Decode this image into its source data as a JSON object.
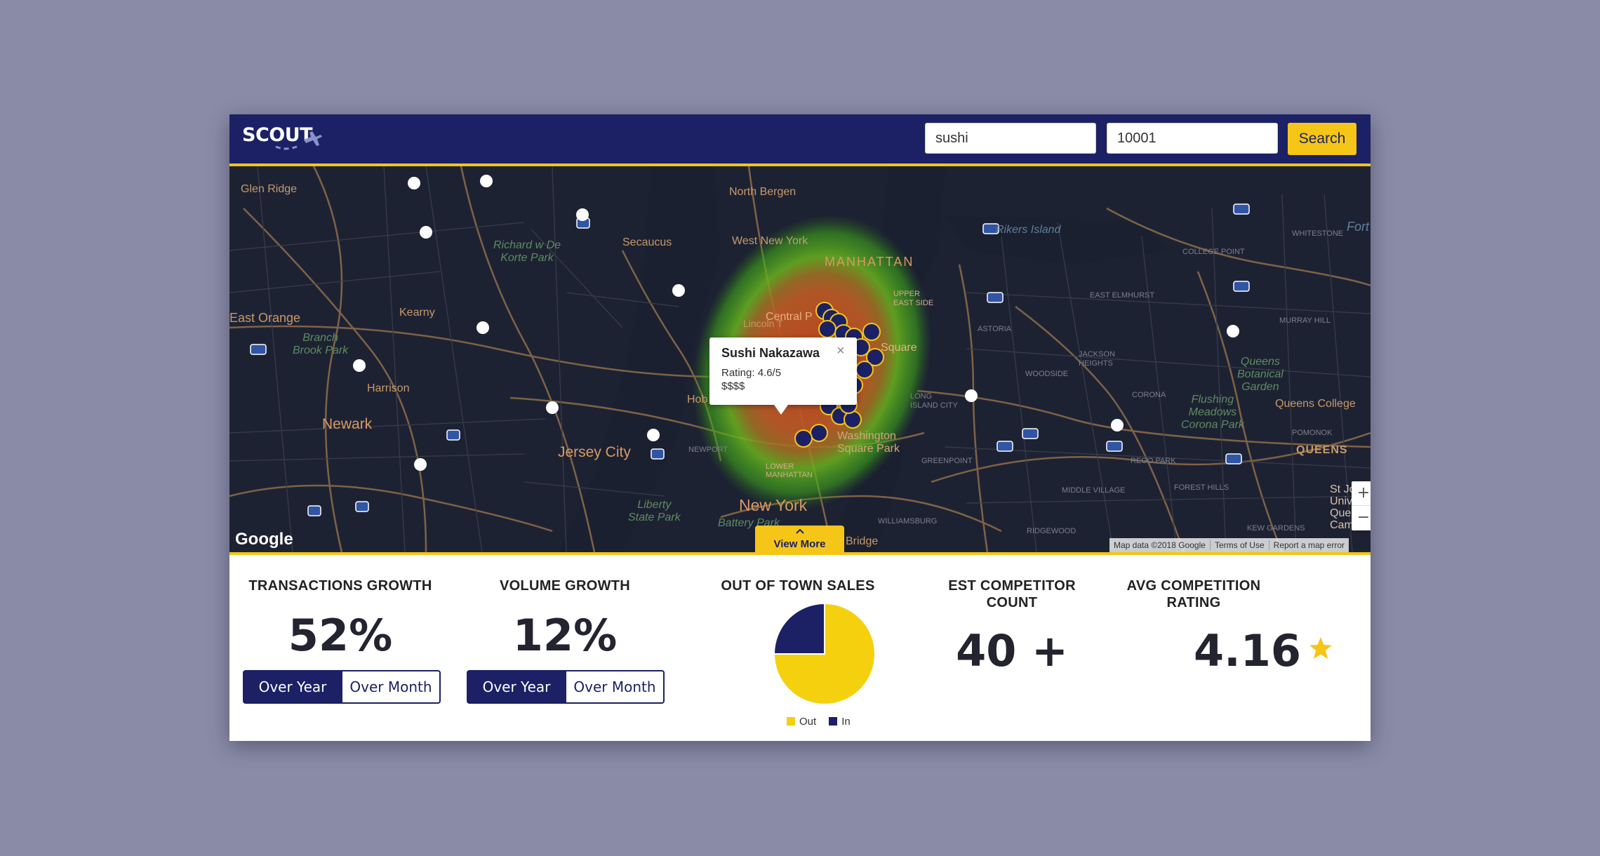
{
  "header": {
    "logo_text": "SCOUT",
    "keyword_value": "sushi",
    "zip_value": "10001",
    "search_label": "Search"
  },
  "map": {
    "labels": {
      "glen_ridge": "Glen Ridge",
      "north_bergen": "North Bergen",
      "secaucus": "Secaucus",
      "west_new_york": "West New York",
      "manhattan": "MANHATTAN",
      "richard": "Richard w De\nKorte Park",
      "east_orange": "East Orange",
      "kearny": "Kearny",
      "branch_brook": "Branch\nBrook Park",
      "harrison": "Harrison",
      "newark": "Newark",
      "jersey_city": "Jersey City",
      "new_york": "New York",
      "liberty": "Liberty\nState Park",
      "battery": "Battery Park",
      "rikers": "Rikers Island",
      "queens_botanical": "Queens\nBotanical\nGarden",
      "flushing": "Flushing\nMeadows\nCorona Park",
      "queens_college": "Queens College",
      "queens": "QUEENS",
      "astoria": "ASTORIA",
      "east_elmhurst": "EAST ELMHURST",
      "jackson": "JACKSON\nHEIGHTS",
      "corona": "CORONA",
      "woodside": "WOODSIDE",
      "college_point": "COLLEGE POINT",
      "whitestone": "WHITESTONE",
      "rego_park": "REGO PARK",
      "middle_village": "MIDDLE VILLAGE",
      "forest_hills": "FOREST HILLS",
      "ridgewood": "RIDGEWOOD",
      "greenpoint": "GREENPOINT",
      "williamsburg": "WILLIAMSBURG",
      "pomonok": "POMONOK",
      "murray_hill": "MURRAY HILL",
      "kew_gardens": "KEW GARDENS",
      "fort": "Fort",
      "stjohn": "St Joh\nUniver\nQuee\nCamp",
      "lower_manhattan": "LOWER\nMANHATTAN",
      "washington_sq": "Washington\nSquare Park",
      "central_park": "Central P",
      "upper_east": "UPPER\nEAST SIDE",
      "long_island": "LONG\nISLAND CITY",
      "newport": "NEWPORT",
      "bridge": "Bridge",
      "square": "Square",
      "hob": "Hob",
      "lincoln": "Lincoln T"
    },
    "popup": {
      "name": "Sushi Nakazawa",
      "rating": "Rating: 4.6/5",
      "price": "$$$$",
      "close": "×"
    },
    "zoom_in": "+",
    "zoom_out": "−",
    "google": "Google",
    "attribution": [
      "Map data ©2018 Google",
      "Terms of Use",
      "Report a map error"
    ],
    "view_more": "View More"
  },
  "stats": {
    "transactions_title": "TRANSACTIONS GROWTH",
    "transactions_value": "52%",
    "volume_title": "VOLUME GROWTH",
    "volume_value": "12%",
    "toggle_year": "Over Year",
    "toggle_month": "Over Month",
    "out_of_town_title": "OUT OF TOWN SALES",
    "competitor_title": "EST COMPETITOR\nCOUNT",
    "competitor_value": "40 +",
    "rating_title": "AVG COMPETITION\nRATING",
    "rating_value": "4.16",
    "star_icon": "star-icon"
  },
  "colors": {
    "navy": "#1b2164",
    "yellow": "#f5c518",
    "map_bg": "#1d2233",
    "background": "#8a8ca7"
  },
  "chart_data": {
    "type": "pie",
    "title": "OUT OF TOWN SALES",
    "series": [
      {
        "name": "Out",
        "value": 75,
        "color": "#f5d00f"
      },
      {
        "name": "In",
        "value": 25,
        "color": "#1b2164"
      }
    ],
    "legend_position": "bottom"
  }
}
